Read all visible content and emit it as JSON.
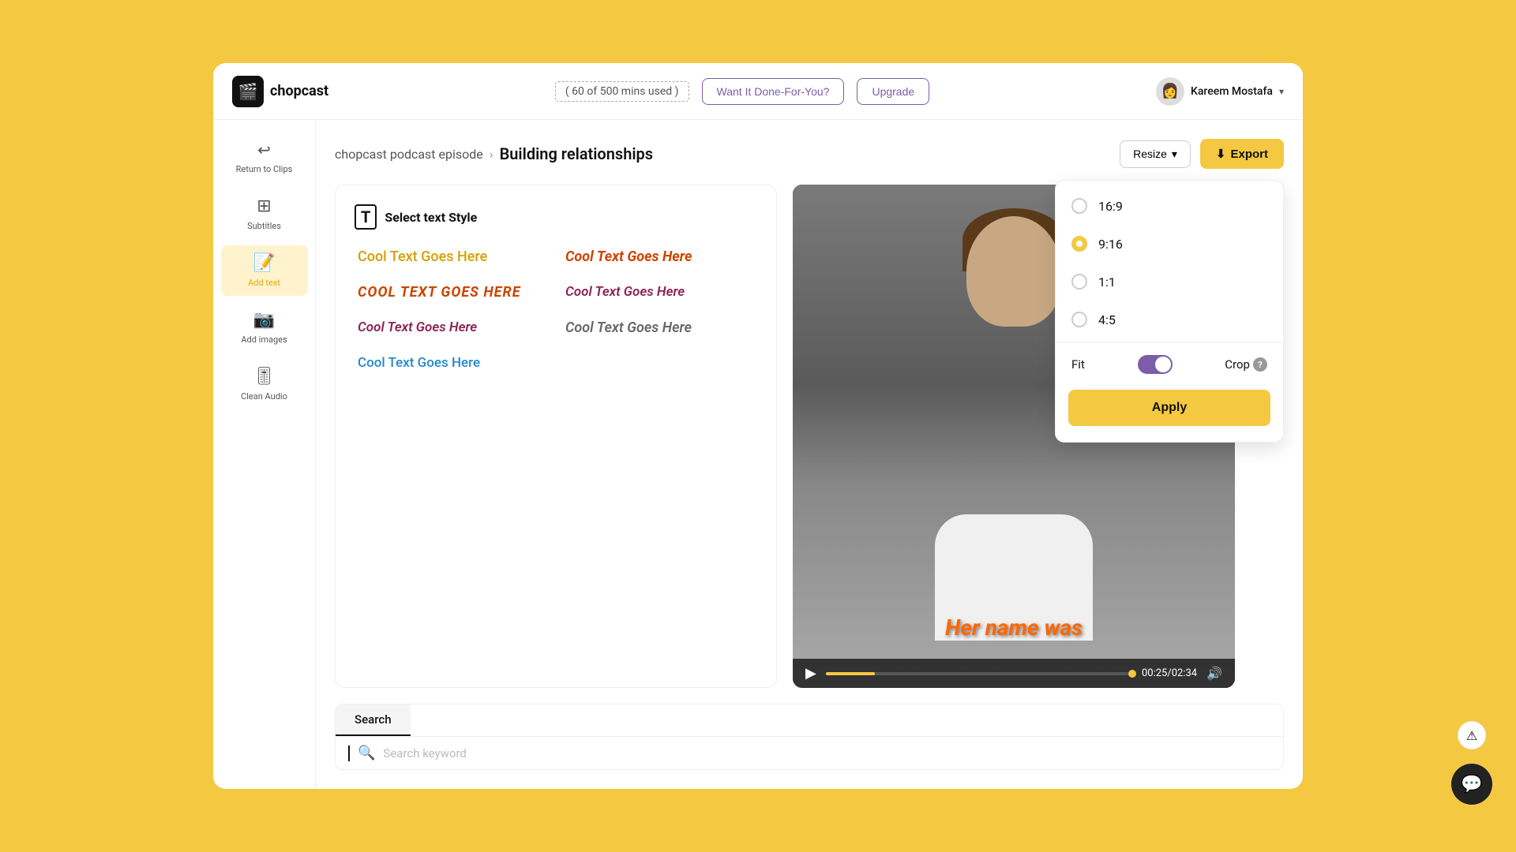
{
  "app": {
    "name": "chopcast",
    "logo_icon": "🎬"
  },
  "top_bar": {
    "usage_text": "( 60 of 500 mins used )",
    "want_done_label": "Want It Done-For-You?",
    "upgrade_label": "Upgrade",
    "user_name": "Kareem Mostafa",
    "user_avatar": "👤"
  },
  "sidebar": {
    "return_label": "Return to Clips",
    "return_icon": "↩",
    "items": [
      {
        "id": "subtitles",
        "label": "Subtitles",
        "icon": "⊞"
      },
      {
        "id": "add-text",
        "label": "Add text",
        "icon": "📝",
        "active": true
      },
      {
        "id": "add-images",
        "label": "Add images",
        "icon": "📷"
      },
      {
        "id": "clean-audio",
        "label": "Clean Audio",
        "icon": "🎚"
      }
    ]
  },
  "breadcrumb": {
    "parent": "chopcast podcast episode",
    "separator": "›",
    "current": "Building relationships"
  },
  "toolbar": {
    "resize_label": "Resize",
    "export_label": "Export",
    "export_icon": "⬇"
  },
  "text_style_panel": {
    "header_icon": "T",
    "header_label": "Select text Style",
    "styles": [
      {
        "id": "style1",
        "text": "Cool Text Goes Here",
        "class": "style1"
      },
      {
        "id": "style2",
        "text": "COOL TEXT GOES HERE",
        "class": "style2"
      },
      {
        "id": "style3",
        "text": "Cool Text Goes Here",
        "class": "style3"
      },
      {
        "id": "style4",
        "text": "Cool Text Goes Here",
        "class": "style4"
      },
      {
        "id": "style5",
        "text": "Cool Text Goes Here",
        "class": "style5"
      },
      {
        "id": "style6",
        "text": "Cool Text Goes Here",
        "class": "style6"
      }
    ]
  },
  "video": {
    "subtitle_text": "Her name was",
    "time_current": "00:25",
    "time_total": "02:34"
  },
  "search": {
    "tab_label": "Search",
    "input_placeholder": "Search keyword"
  },
  "resize_dropdown": {
    "options": [
      {
        "id": "16-9",
        "label": "16:9",
        "selected": false
      },
      {
        "id": "9-16",
        "label": "9:16",
        "selected": true
      },
      {
        "id": "1-1",
        "label": "1:1",
        "selected": false
      },
      {
        "id": "4-5",
        "label": "4:5",
        "selected": false
      }
    ],
    "fit_label": "Fit",
    "crop_label": "Crop",
    "apply_label": "Apply"
  },
  "support": {
    "chat_icon": "💬",
    "alert_icon": "⚠"
  }
}
